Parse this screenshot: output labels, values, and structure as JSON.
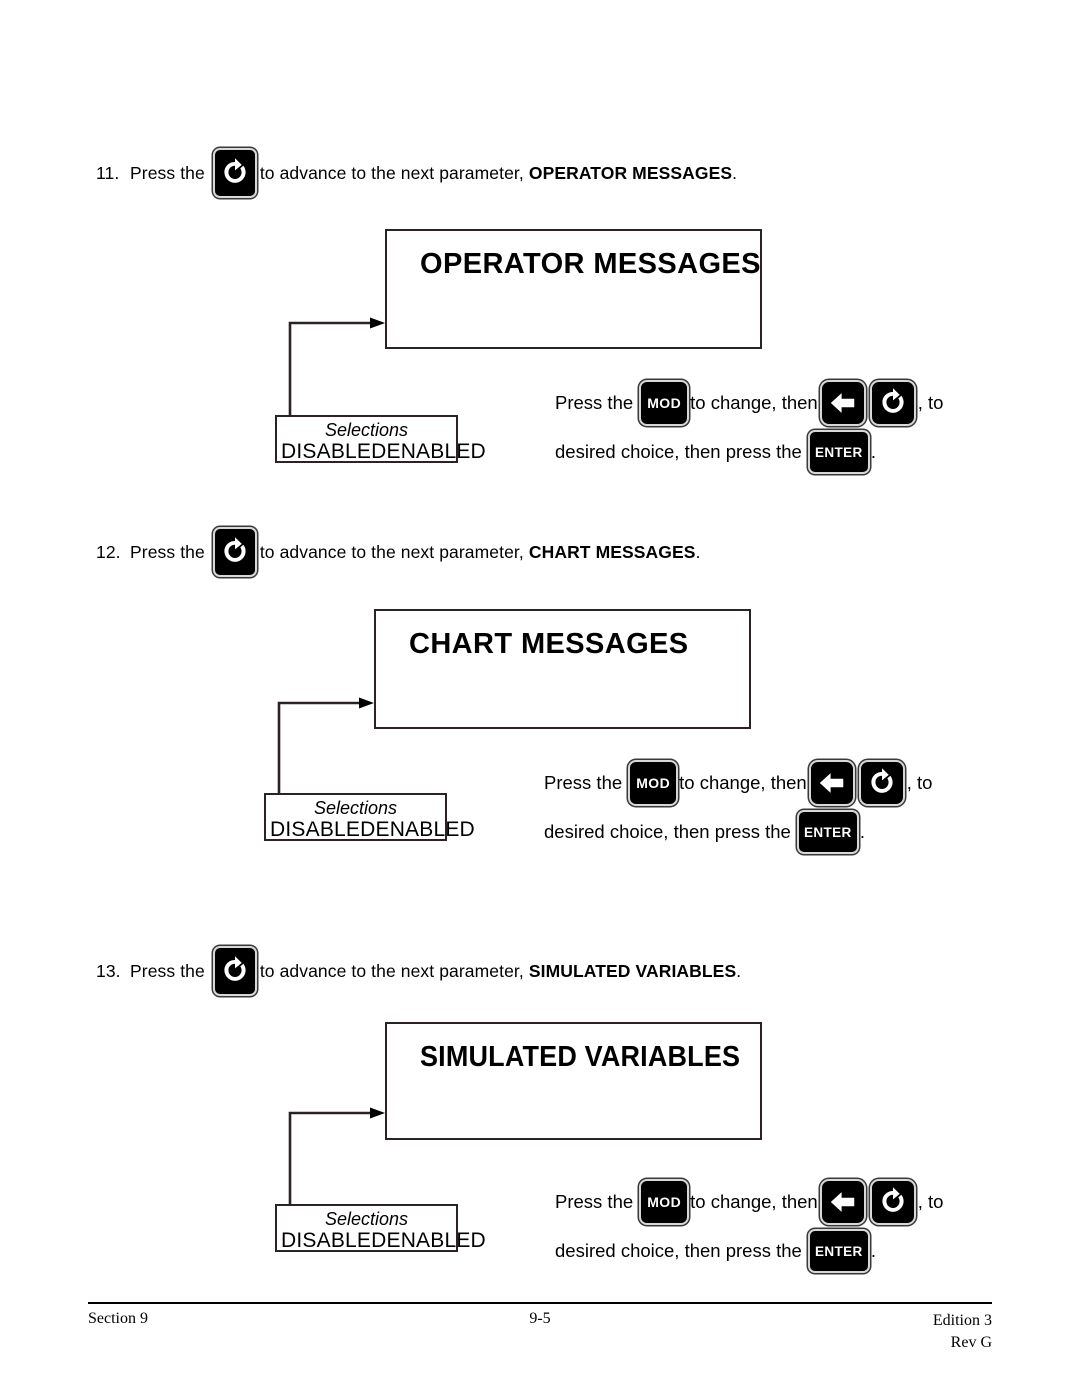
{
  "page": {
    "background": "#ffffff",
    "ink": "#000000",
    "box_border_color": "#2b2227"
  },
  "steps": [
    {
      "number": "11.",
      "text_before": "Press the",
      "icon": "rotate-advance-icon",
      "text_after": "to advance to the next parameter,",
      "parameter": "OPERATOR MESSAGES",
      "period": "."
    },
    {
      "number": "12.",
      "text_before": "Press the",
      "icon": "rotate-advance-icon",
      "text_after": "to advance to the next parameter,",
      "parameter": "CHART MESSAGES",
      "period": "."
    },
    {
      "number": "13.",
      "text_before": "Press the",
      "icon": "rotate-advance-icon",
      "text_after": "to advance to the next parameter,",
      "parameter": "SIMULATED VARIABLES",
      "period": "."
    }
  ],
  "sections": [
    {
      "display_title": "OPERATOR MESSAGES",
      "selections_label": "Selections",
      "selection_options": [
        "DISABLED",
        "ENABLED"
      ],
      "instruction": {
        "line1_a": "Press the",
        "line1_b": "to change, then",
        "line1_c": ", to",
        "line2_a": "desired choice, then press the",
        "line2_b": ".",
        "keys": [
          "mod-key",
          "left-arrow-key",
          "rotate-advance-key",
          "enter-key"
        ]
      }
    },
    {
      "display_title": "CHART MESSAGES",
      "selections_label": "Selections",
      "selection_options": [
        "DISABLED",
        "ENABLED"
      ],
      "instruction": {
        "line1_a": "Press the",
        "line1_b": "to change, then",
        "line1_c": ", to",
        "line2_a": "desired choice, then press the",
        "line2_b": ".",
        "keys": [
          "mod-key",
          "left-arrow-key",
          "rotate-advance-key",
          "enter-key"
        ]
      }
    },
    {
      "display_title": "SIMULATED VARIABLES",
      "selections_label": "Selections",
      "selection_options": [
        "DISABLED",
        "ENABLED"
      ],
      "instruction": {
        "line1_a": "Press the",
        "line1_b": "to change, then",
        "line1_c": ", to",
        "line2_a": "desired choice, then press the",
        "line2_b": ".",
        "keys": [
          "mod-key",
          "left-arrow-key",
          "rotate-advance-key",
          "enter-key"
        ]
      }
    }
  ],
  "keys": {
    "mod_label": "MOD",
    "enter_label": "ENTER"
  },
  "footer": {
    "left": "Section 9",
    "center": "9-5",
    "right_line1": "Edition 3",
    "right_line2": "Rev G"
  }
}
